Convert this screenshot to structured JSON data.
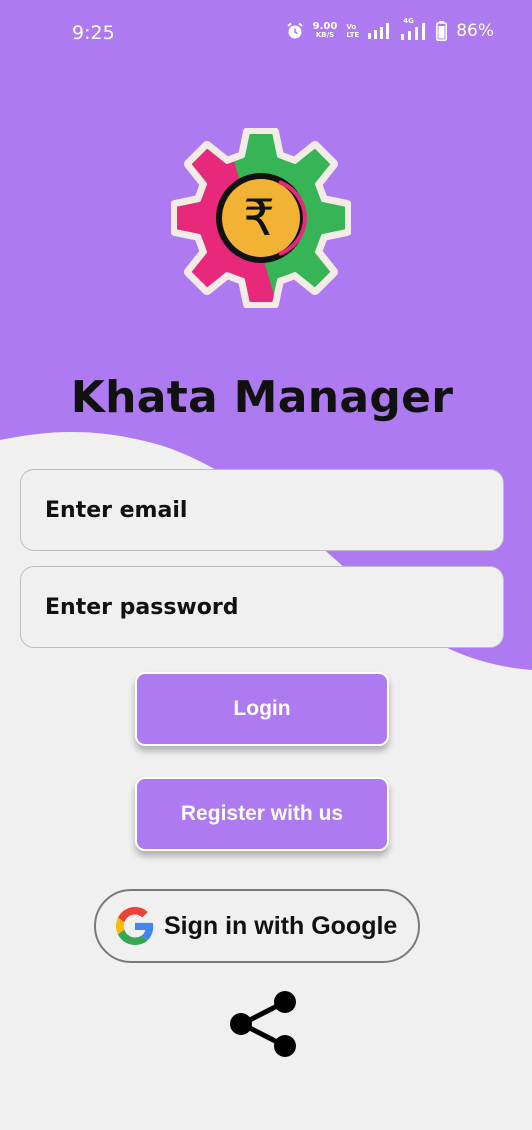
{
  "status_bar": {
    "time": "9:25",
    "net_speed_value": "9.00",
    "net_speed_unit": "KB/S",
    "volte_top": "Vo",
    "volte_bottom": "LTE",
    "network_label": "4G",
    "battery_percent": "86%"
  },
  "icons": {
    "alarm": "alarm-icon",
    "signal": "signal-icon",
    "battery": "battery-icon",
    "logo": "rupee-gear-logo",
    "google": "google-g-icon",
    "share": "share-icon"
  },
  "logo": {
    "symbol": "₹"
  },
  "app": {
    "title": "Khata Manager"
  },
  "form": {
    "email_placeholder": "Enter email",
    "password_placeholder": "Enter password",
    "login_label": "Login",
    "register_label": "Register with us",
    "google_label": "Sign in with Google"
  },
  "colors": {
    "accent": "#ad7af2",
    "background": "#f0f0f0",
    "logo_green": "#36b456",
    "logo_pink": "#e8287a",
    "logo_gold": "#f2b233"
  }
}
